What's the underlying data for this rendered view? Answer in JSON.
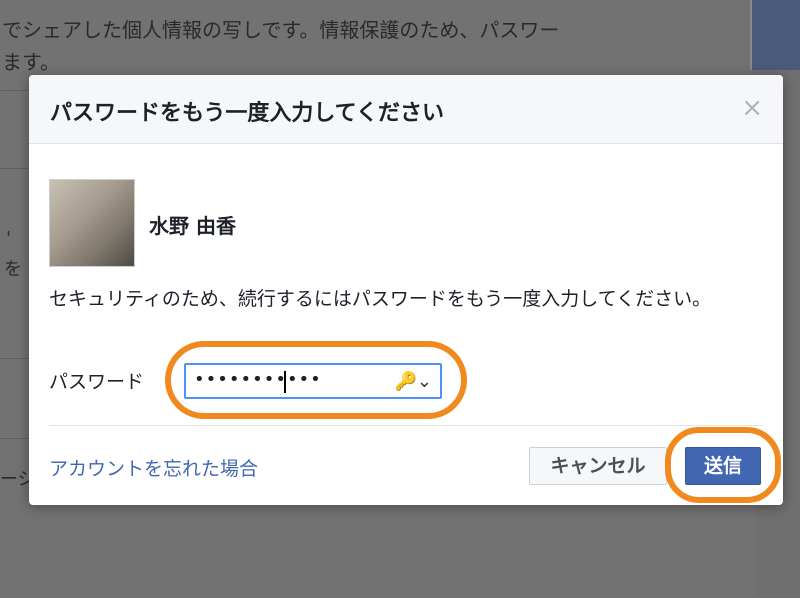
{
  "background": {
    "line1": "でシェアした個人情報の写しです。情報保護のため、パスワー",
    "line2": "ます。",
    "frag_left1": "'",
    "frag_left2": "を",
    "frag_left3": "ージ"
  },
  "dialog": {
    "title": "パスワードをもう一度入力してください",
    "close_glyph": "×",
    "profile_name": "水野 由香",
    "message": "セキュリティのため、続行するにはパスワードをもう一度入力してください。",
    "password_label": "パスワード",
    "password_value": "•••••••••••",
    "key_glyph": "🔑⌄",
    "forgot_link": "アカウントを忘れた場合",
    "cancel_label": "キャンセル",
    "submit_label": "送信"
  },
  "colors": {
    "accent": "#4267b2",
    "highlight": "#f08a1e",
    "focus": "#4d90fe"
  }
}
